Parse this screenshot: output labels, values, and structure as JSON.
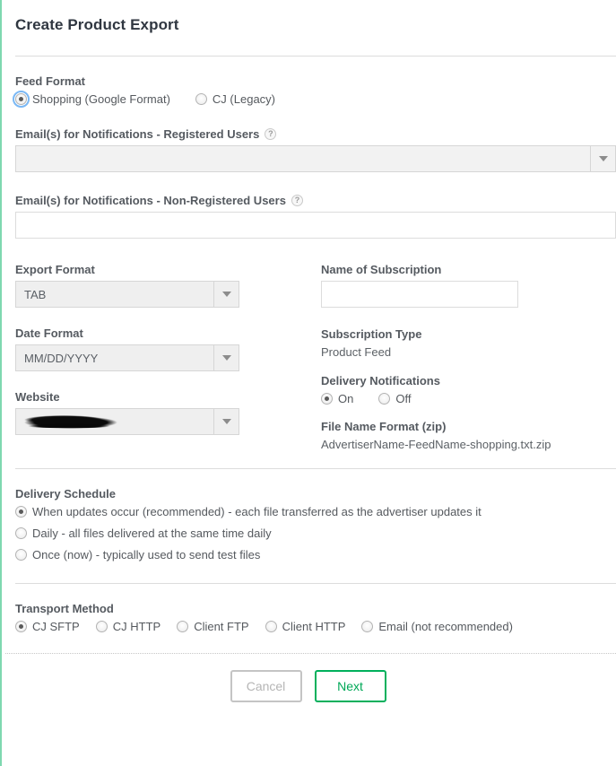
{
  "page": {
    "title": "Create Product Export",
    "accent_color": "#7fd8b0"
  },
  "feed_format": {
    "label": "Feed Format",
    "options": [
      {
        "label": "Shopping (Google Format)",
        "selected": true
      },
      {
        "label": "CJ (Legacy)",
        "selected": false
      }
    ]
  },
  "email_registered": {
    "label": "Email(s) for Notifications - Registered Users",
    "help_icon": "question-mark-icon",
    "value": ""
  },
  "email_non_registered": {
    "label": "Email(s) for Notifications - Non-Registered Users",
    "help_icon": "question-mark-icon",
    "value": ""
  },
  "export_format": {
    "label": "Export Format",
    "value": "TAB"
  },
  "date_format": {
    "label": "Date Format",
    "value": "MM/DD/YYYY"
  },
  "website": {
    "label": "Website",
    "value": ""
  },
  "subscription_name": {
    "label": "Name of Subscription",
    "value": "",
    "placeholder": ""
  },
  "subscription_type": {
    "label": "Subscription Type",
    "value": "Product Feed"
  },
  "delivery_notifications": {
    "label": "Delivery Notifications",
    "options": [
      {
        "label": "On",
        "selected": true
      },
      {
        "label": "Off",
        "selected": false
      }
    ]
  },
  "file_name_format": {
    "label": "File Name Format (zip)",
    "value": "AdvertiserName-FeedName-shopping.txt.zip"
  },
  "delivery_schedule": {
    "label": "Delivery Schedule",
    "options": [
      {
        "label": "When updates occur (recommended) - each file transferred as the advertiser updates it",
        "selected": true
      },
      {
        "label": "Daily - all files delivered at the same time daily",
        "selected": false
      },
      {
        "label": "Once (now) - typically used to send test files",
        "selected": false
      }
    ]
  },
  "transport_method": {
    "label": "Transport Method",
    "options": [
      {
        "label": "CJ SFTP",
        "selected": true
      },
      {
        "label": "CJ HTTP",
        "selected": false
      },
      {
        "label": "Client FTP",
        "selected": false
      },
      {
        "label": "Client HTTP",
        "selected": false
      },
      {
        "label": "Email (not recommended)",
        "selected": false
      }
    ]
  },
  "footer": {
    "cancel_label": "Cancel",
    "next_label": "Next",
    "next_color": "#00a857"
  }
}
